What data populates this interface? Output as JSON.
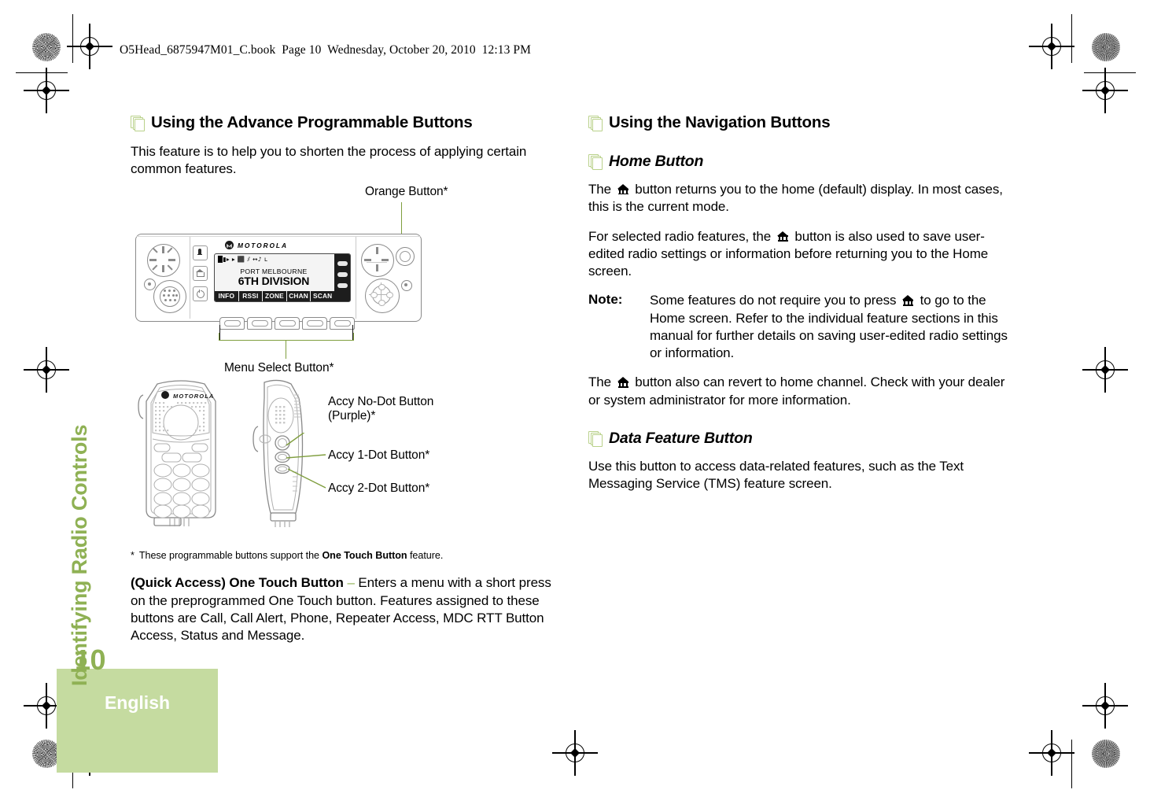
{
  "document": {
    "book_header": "O5Head_6875947M01_C.book  Page 10  Wednesday, October 20, 2010  12:13 PM",
    "chapter_tab": "Identifying Radio Controls",
    "page_number": "10",
    "language": "English",
    "colors": {
      "accent_green": "#8fb154",
      "tab_green": "#c5dba0",
      "icon_green": "#b9d18a",
      "callout_green": "#7f9e3e"
    }
  },
  "left_column": {
    "heading": "Using the Advance Programmable Buttons",
    "intro": "This feature is to help you to shorten the process of applying certain common features.",
    "footnote_star": "*",
    "footnote_pre": "These programmable buttons support the ",
    "footnote_bold": "One Touch Button",
    "footnote_post": " feature.",
    "quick_access_bold": "(Quick Access) One Touch Button",
    "quick_access_dash": "–",
    "quick_access_body": " Enters a menu with a short press on the preprogrammed One Touch button. Features assigned to these buttons are Call, Call Alert, Phone, Repeater Access, MDC RTT Button Access, Status and Message."
  },
  "figure_radio": {
    "callout_orange": "Orange Button*",
    "callout_menu": "Menu Select Button*",
    "brand": "MOTOROLA",
    "lcd": {
      "status_icons": "█▮▸ ▸ ⬛ ⫽  ↔♪ ʟ",
      "line1": "PORT MELBOURNE",
      "line2": "6TH DIVISION",
      "softkeys": [
        "INFO",
        "RSSI",
        "ZONE",
        "CHAN",
        "SCAN"
      ]
    }
  },
  "figure_mic": {
    "brand": "MOTOROLA",
    "callout_nodot_l1": "Accy No-Dot Button",
    "callout_nodot_l2": "(Purple)*",
    "callout_1dot": "Accy 1-Dot Button*",
    "callout_2dot": "Accy 2-Dot Button*"
  },
  "right_column": {
    "heading": "Using the Navigation Buttons",
    "home_heading": "Home Button",
    "home_p1_a": "The ",
    "home_p1_b": " button returns you to the home (default) display. In most cases, this is the current mode.",
    "home_p2_a": "For selected radio features, the ",
    "home_p2_b": " button is also used to save user-edited radio settings or information before returning you to the Home screen.",
    "note_label": "Note:",
    "note_a": "Some features do not require you to press ",
    "note_b": " to go to the Home screen. Refer to the individual feature sections in this manual for further details on saving user-edited radio settings or information.",
    "home_p3_a": "The ",
    "home_p3_b": " button also can revert to home channel. Check with your dealer or system administrator for more information.",
    "data_heading": "Data Feature Button",
    "data_body": "Use this button to access data-related features, such as the Text Messaging Service (TMS) feature screen."
  }
}
